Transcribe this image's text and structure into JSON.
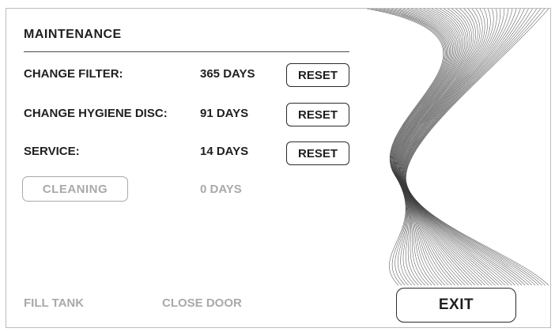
{
  "header": {
    "title": "MAINTENANCE"
  },
  "rows": [
    {
      "label": "CHANGE FILTER:",
      "value": "365 DAYS",
      "button": "RESET"
    },
    {
      "label": "CHANGE HYGIENE DISC:",
      "value": "91 DAYS",
      "button": "RESET"
    },
    {
      "label": "SERVICE:",
      "value": "14 DAYS",
      "button": "RESET"
    }
  ],
  "cleaning": {
    "button": "CLEANING",
    "value": "0 DAYS"
  },
  "footer": {
    "fill_tank": "FILL TANK",
    "close_door": "CLOSE DOOR",
    "exit": "EXIT"
  },
  "colors": {
    "text": "#1f1f1f",
    "disabled": "#a9a9a9",
    "border": "#bdbdbd"
  },
  "icons": {
    "decorative_art": "wave-ribbon-art"
  }
}
